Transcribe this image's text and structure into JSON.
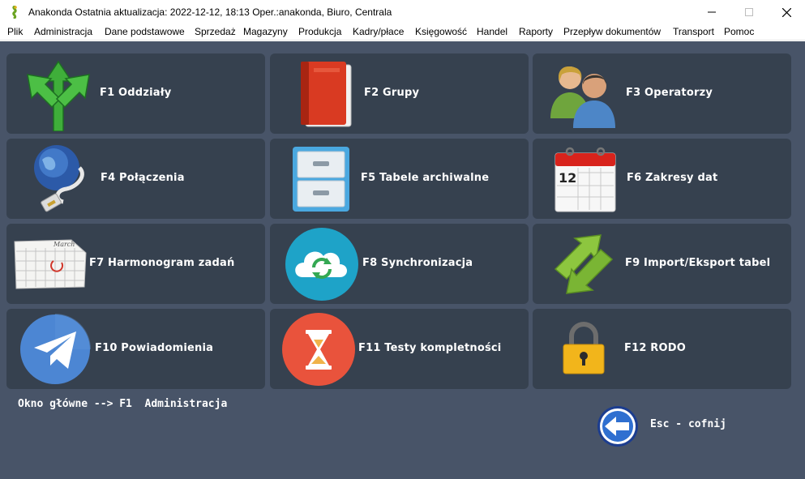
{
  "window": {
    "title": "Anakonda Ostatnia aktualizacja: 2022-12-12, 18:13 Oper.:anakonda, Biuro, Centrala",
    "controls": [
      "minimize-icon",
      "maximize-icon",
      "close-icon"
    ]
  },
  "menu": [
    {
      "label": "Plik"
    },
    {
      "label": "Administracja"
    },
    {
      "label": "Dane podstawowe"
    },
    {
      "label": "Sprzedaż"
    },
    {
      "label": "Magazyny"
    },
    {
      "label": "Produkcja"
    },
    {
      "label": "Kadry/płace"
    },
    {
      "label": "Księgowość"
    },
    {
      "label": "Handel"
    },
    {
      "label": "Raporty"
    },
    {
      "label": "Przepływ dokumentów"
    },
    {
      "label": "Transport"
    },
    {
      "label": "Pomoc"
    }
  ],
  "tiles": [
    {
      "label": "F1 Oddziały",
      "icon": "branch-arrows-icon"
    },
    {
      "label": "F2 Grupy",
      "icon": "red-book-icon"
    },
    {
      "label": "F3 Operatorzy",
      "icon": "users-icon"
    },
    {
      "label": "F4 Połączenia",
      "icon": "globe-network-icon"
    },
    {
      "label": "F5 Tabele archiwalne",
      "icon": "file-cabinet-icon"
    },
    {
      "label": "F6 Zakresy dat",
      "icon": "calendar-icon"
    },
    {
      "label": "F7 Harmonogram zadań",
      "icon": "schedule-calendar-icon"
    },
    {
      "label": "F8 Synchronizacja",
      "icon": "cloud-sync-icon"
    },
    {
      "label": "F9 Import/Eksport tabel",
      "icon": "import-export-arrows-icon"
    },
    {
      "label": "F10 Powiadomienia",
      "icon": "paper-plane-icon"
    },
    {
      "label": "F11 Testy kompletności",
      "icon": "hourglass-icon"
    },
    {
      "label": "F12 RODO",
      "icon": "padlock-icon"
    }
  ],
  "calendar_icon_day": "12",
  "schedule_icon_month": "March",
  "breadcrumb": "Okno główne --> F1  Administracja",
  "back_button": {
    "label": "Esc - cofnij",
    "icon": "back-arrow-icon"
  },
  "colors": {
    "background": "#485468",
    "tile": "#36414f",
    "text": "#ffffff"
  }
}
